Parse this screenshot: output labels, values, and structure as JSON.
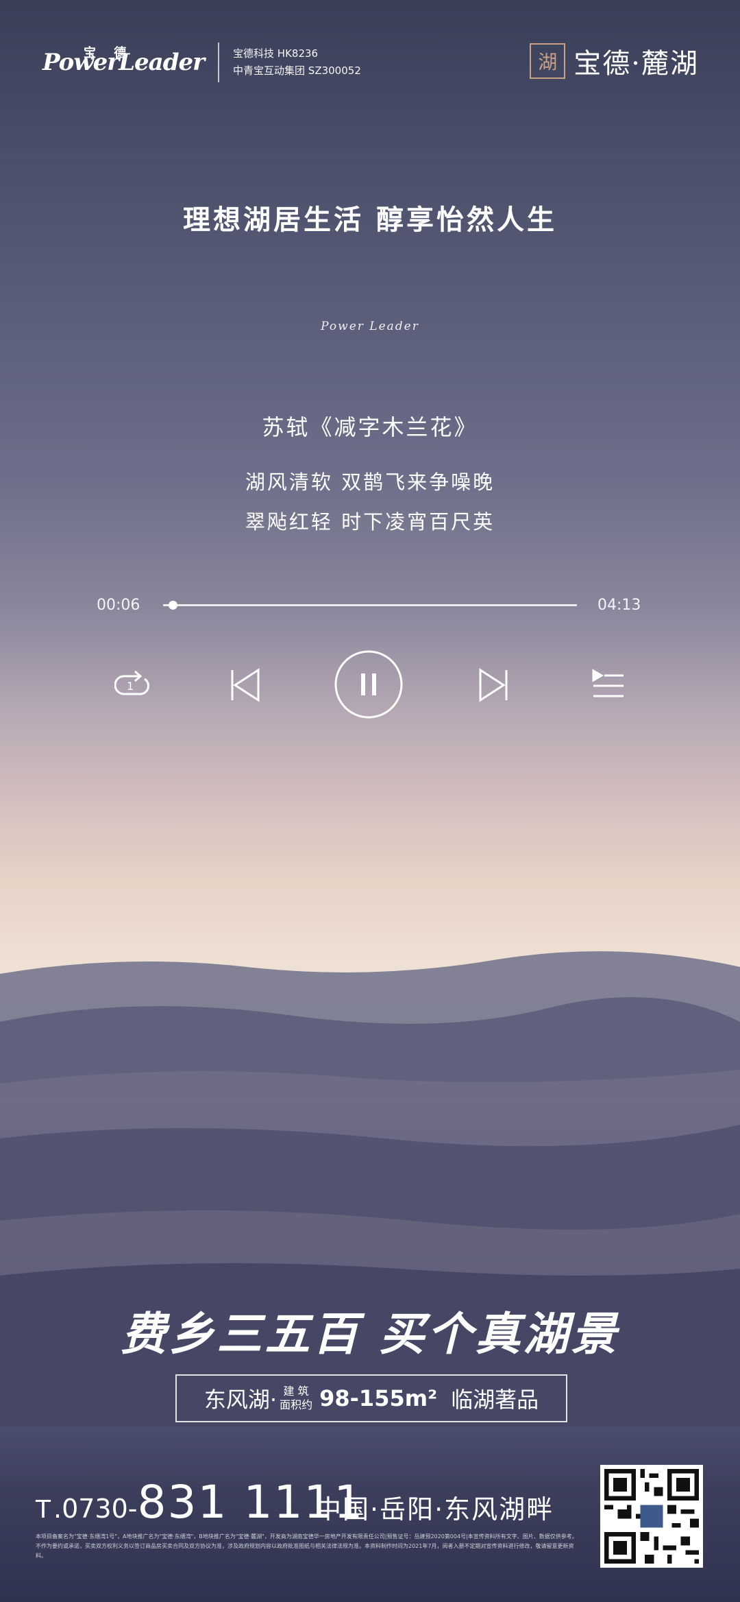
{
  "brand": {
    "logo_cn": "宝 德",
    "logo_en": "PowerLeader",
    "line1": "宝德科技 HK8236",
    "line2": "中青宝互动集团 SZ300052",
    "project_seal": "湖",
    "project_name": "宝德·麓湖"
  },
  "headline": "理想湖居生活  醇享怡然人生",
  "script_mark": "Power Leader",
  "poem": {
    "title": "苏轼《减字木兰花》",
    "line1": "湖风清软 双鹊飞来争噪晚",
    "line2": "翠飐红轻 时下凌宵百尺英"
  },
  "player": {
    "current_time": "00:06",
    "total_time": "04:13",
    "progress": 0.024,
    "icons": [
      "repeat-one-icon",
      "previous-icon",
      "pause-icon",
      "next-icon",
      "playlist-icon"
    ]
  },
  "slogan": "费乡三五百  买个真湖景",
  "tagline": {
    "lake": "东风湖·",
    "area_label_top": "建 筑",
    "area_label_bottom": "面积约",
    "area": "98-155m²",
    "desc": "临湖著品"
  },
  "contact": {
    "tel_icon": "T",
    "area_code": ".0730-",
    "number": "831 1111",
    "location": "中国·岳阳·东风湖畔"
  },
  "fine_print": {
    "line1": "本项目备案名为\"宝德·东缙湾1号\"，A地块推广名为\"宝德·东缙湾\"，B地块推广名为\"宝德·麓湖\"，开发商为湖南宝德华一房地产开发有限责任公司|预售证号：岳建预2020第004号|本宣传资料所有文字、图片、数据仅供参考。",
    "line2": "不作为要约或承诺，买卖双方权利义务以签订商品房买卖合同及双方协议为准，涉及政府规划内容以政府批准图纸与相关法律法规为准。本资料制作时间为2021年7月，阅者入册不定期对宣传资料进行修改，敬请留意更新资料。"
  },
  "colors": {
    "accent_seal": "#c9a186",
    "sky_top": "#3a3f58",
    "horizon": "#efe0d4"
  }
}
